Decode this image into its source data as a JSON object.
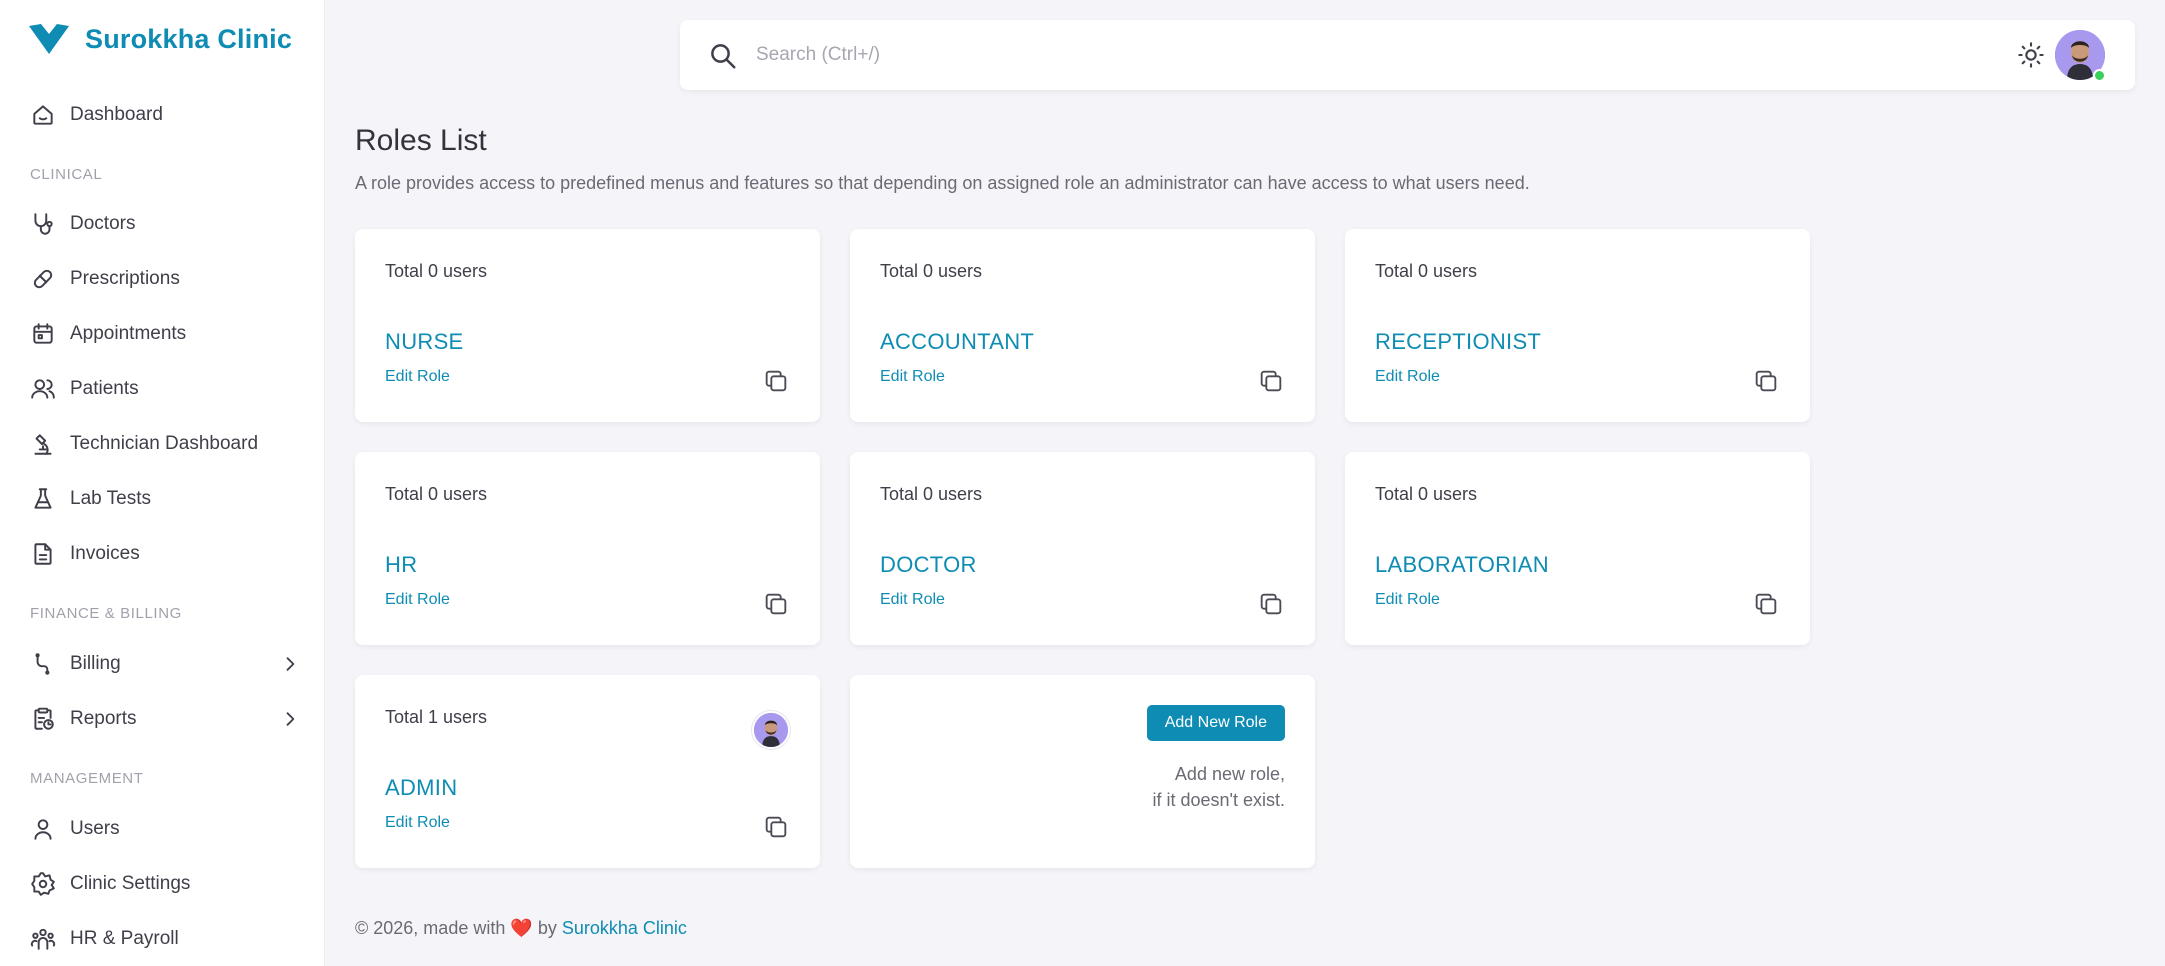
{
  "brand": {
    "name": "Surokkha Clinic",
    "color": "#0e8cb3"
  },
  "sidebar": {
    "items": [
      {
        "label": "Dashboard",
        "icon": "home-icon"
      },
      {
        "section": "CLINICAL"
      },
      {
        "label": "Doctors",
        "icon": "stethoscope-icon"
      },
      {
        "label": "Prescriptions",
        "icon": "pill-icon"
      },
      {
        "label": "Appointments",
        "icon": "calendar-icon"
      },
      {
        "label": "Patients",
        "icon": "users-icon"
      },
      {
        "label": "Technician Dashboard",
        "icon": "microscope-icon"
      },
      {
        "label": "Lab Tests",
        "icon": "flask-icon"
      },
      {
        "label": "Invoices",
        "icon": "file-invoice-icon"
      },
      {
        "section": "FINANCE & BILLING"
      },
      {
        "label": "Billing",
        "icon": "billing-icon",
        "expandable": true
      },
      {
        "label": "Reports",
        "icon": "report-icon",
        "expandable": true
      },
      {
        "section": "MANAGEMENT"
      },
      {
        "label": "Users",
        "icon": "user-icon"
      },
      {
        "label": "Clinic Settings",
        "icon": "gear-icon"
      },
      {
        "label": "HR & Payroll",
        "icon": "team-icon"
      }
    ],
    "labels": {
      "dashboard": "Dashboard",
      "clinical": "CLINICAL",
      "doctors": "Doctors",
      "prescriptions": "Prescriptions",
      "appointments": "Appointments",
      "patients": "Patients",
      "technician": "Technician Dashboard",
      "labtests": "Lab Tests",
      "invoices": "Invoices",
      "finance": "FINANCE & BILLING",
      "billing": "Billing",
      "reports": "Reports",
      "management": "MANAGEMENT",
      "users": "Users",
      "clinic_settings": "Clinic Settings",
      "hr_payroll": "HR & Payroll"
    }
  },
  "search": {
    "placeholder": "Search (Ctrl+/)"
  },
  "page": {
    "title": "Roles List",
    "description": "A role provides access to predefined menus and features so that depending on assigned role an administrator can have access to what users need."
  },
  "roles": [
    {
      "total": "Total 0 users",
      "name": "NURSE",
      "edit": "Edit Role"
    },
    {
      "total": "Total 0 users",
      "name": "ACCOUNTANT",
      "edit": "Edit Role"
    },
    {
      "total": "Total 0 users",
      "name": "RECEPTIONIST",
      "edit": "Edit Role"
    },
    {
      "total": "Total 0 users",
      "name": "HR",
      "edit": "Edit Role"
    },
    {
      "total": "Total 0 users",
      "name": "DOCTOR",
      "edit": "Edit Role"
    },
    {
      "total": "Total 0 users",
      "name": "LABORATORIAN",
      "edit": "Edit Role"
    },
    {
      "total": "Total 1 users",
      "name": "ADMIN",
      "edit": "Edit Role"
    }
  ],
  "add_role": {
    "button": "Add New Role",
    "line1": "Add new role,",
    "line2": "if it doesn't exist."
  },
  "footer": {
    "prefix": "© 2026, made with",
    "heart": "❤️",
    "by": "by",
    "link": "Surokkha Clinic"
  },
  "colors": {
    "accent": "#0e8cb3",
    "background": "#f5f5f9",
    "online": "#39d05a"
  }
}
